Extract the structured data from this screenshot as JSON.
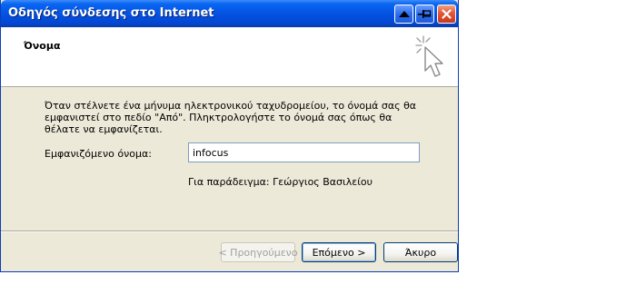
{
  "window": {
    "title": "Οδηγός σύνδεσης στο Internet"
  },
  "header": {
    "title": "Όνομα"
  },
  "content": {
    "description": "Όταν στέλνετε ένα μήνυμα ηλεκτρονικού ταχυδρομείου, το όνομά σας θα εμφανιστεί στο πεδίο \"Από\". Πληκτρολογήστε το όνομά σας όπως θα θέλατε να εμφανίζεται.",
    "name_label": "Εμφανιζόμενο όνομα:",
    "name_value": "infocus",
    "example": "Για παράδειγμα: Γεώργιος Βασιλείου"
  },
  "buttons": {
    "back": "< Προηγούμενο",
    "next": "Επόμενο >",
    "cancel": "Άκυρο"
  },
  "icons": {
    "wizard": "wizard-cursor-icon",
    "up": "triangle-up-icon",
    "pin": "pin-icon",
    "close": "close-icon"
  },
  "colors": {
    "titlebar": "#0550e0",
    "dialog_bg": "#ece9d8",
    "close_button": "#e2573a"
  }
}
